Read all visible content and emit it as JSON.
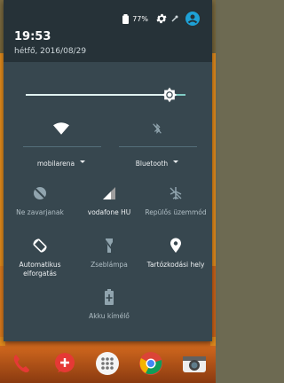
{
  "status": {
    "battery": "77%"
  },
  "header": {
    "time": "19:53",
    "date": "hétfő, 2016/08/29"
  },
  "brightness": {
    "level": 0.9
  },
  "tiles_row1": [
    {
      "label": "mobilarena",
      "icon": "wifi-icon"
    },
    {
      "label": "Bluetooth",
      "icon": "bluetooth-off-icon"
    }
  ],
  "tiles_row2": [
    {
      "label": "Ne zavarjanak",
      "icon": "do-not-disturb-icon"
    },
    {
      "label": "vodafone HU",
      "icon": "signal-icon"
    },
    {
      "label": "Repülős üzemmód",
      "icon": "airplane-icon"
    }
  ],
  "tiles_row3": [
    {
      "label": "Automatikus elforgatás",
      "icon": "auto-rotate-icon"
    },
    {
      "label": "Zseblámpa",
      "icon": "flashlight-icon"
    },
    {
      "label": "Tartózkodási hely",
      "icon": "location-icon"
    }
  ],
  "tiles_row4": [
    {
      "label": "Akku kímélő",
      "icon": "battery-saver-icon"
    }
  ],
  "dock": [
    "phone-icon",
    "messages-icon",
    "apps-icon",
    "chrome-icon",
    "camera-icon"
  ]
}
